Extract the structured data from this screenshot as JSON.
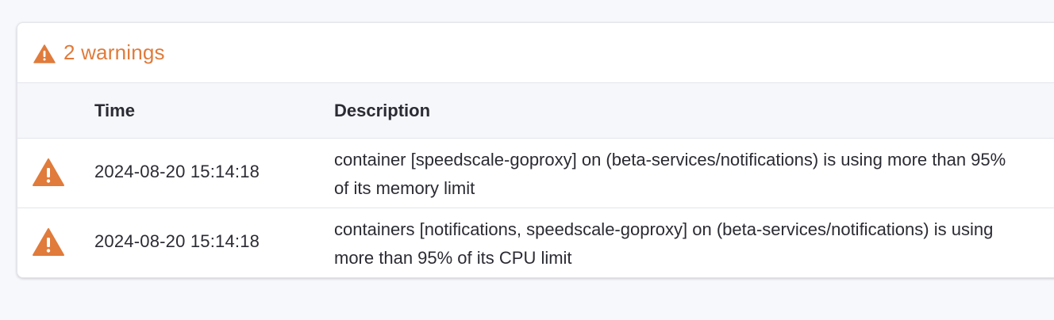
{
  "warnings": {
    "title": "2 warnings",
    "icon": "warning-triangle-icon",
    "accent_color": "#e07b3b"
  },
  "table": {
    "headers": {
      "time": "Time",
      "description": "Description"
    },
    "rows": [
      {
        "icon": "warning-triangle-icon",
        "time": "2024-08-20 15:14:18",
        "description": "container [speedscale-goproxy] on (beta-services/notifications) is using more than 95% of its memory limit"
      },
      {
        "icon": "warning-triangle-icon",
        "time": "2024-08-20 15:14:18",
        "description": "containers [notifications, speedscale-goproxy] on (beta-services/notifications) is using more than 95% of its CPU limit"
      }
    ]
  }
}
